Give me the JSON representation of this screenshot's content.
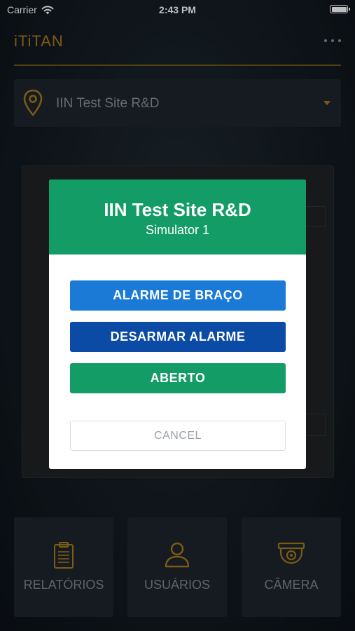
{
  "status_bar": {
    "carrier": "Carrier",
    "time": "2:43 PM",
    "battery_level": 1.0
  },
  "header": {
    "app_title": "iTiTAN",
    "menu_icon": "more-horizontal-icon"
  },
  "site_selector": {
    "icon": "location-pin-icon",
    "value": "IIN Test Site R&D",
    "caret_icon": "caret-down-icon"
  },
  "modal": {
    "title": "IIN Test Site R&D",
    "subtitle": "Simulator 1",
    "buttons": {
      "arm": "ALARME DE BRAÇO",
      "disarm": "DESARMAR ALARME",
      "open": "ABERTO",
      "cancel": "CANCEL"
    }
  },
  "tiles": [
    {
      "label": "RELATÓRIOS",
      "icon": "clipboard-icon"
    },
    {
      "label": "USUÁRIOS",
      "icon": "user-icon"
    },
    {
      "label": "CÂMERA",
      "icon": "security-camera-icon"
    }
  ],
  "colors": {
    "accent_gold": "#a67a1c",
    "modal_header_green": "#139c65",
    "arm_blue": "#1b7ad6",
    "disarm_blue": "#0b4aa5",
    "open_green": "#139c65"
  }
}
